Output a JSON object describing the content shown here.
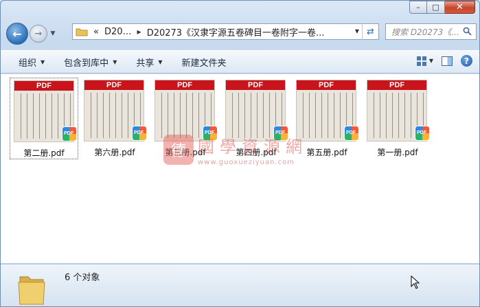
{
  "window": {
    "caption_buttons": {
      "minimize": "–",
      "maximize": "□",
      "close": "✕"
    }
  },
  "nav": {
    "back_icon": "arrow-left-icon",
    "forward_icon": "arrow-right-icon",
    "address": {
      "overflow": "«",
      "segment1": "D20…",
      "segment2": "D20273《汉隶字源五卷碑目一卷附字一卷..."
    },
    "search_placeholder": "搜索 D20273《..."
  },
  "toolbar": {
    "items": [
      {
        "label": "组织",
        "has_dropdown": true
      },
      {
        "label": "包含到库中",
        "has_dropdown": true
      },
      {
        "label": "共享",
        "has_dropdown": true
      },
      {
        "label": "新建文件夹",
        "has_dropdown": false
      }
    ]
  },
  "files": [
    {
      "name": "第二册.pdf",
      "badge": "PDF",
      "selected": true
    },
    {
      "name": "第六册.pdf",
      "badge": "PDF",
      "selected": false
    },
    {
      "name": "第三册.pdf",
      "badge": "PDF",
      "selected": false
    },
    {
      "name": "第四册.pdf",
      "badge": "PDF",
      "selected": false
    },
    {
      "name": "第五册.pdf",
      "badge": "PDF",
      "selected": false
    },
    {
      "name": "第一册.pdf",
      "badge": "PDF",
      "selected": false
    }
  ],
  "watermark": {
    "seal": "德",
    "text": "國學資源網",
    "url": "www.guoxueziyuan.com"
  },
  "status": {
    "count_text": "6 个对象"
  },
  "colors": {
    "pdf_banner": "#c8141a",
    "window_frame": "#c7daee",
    "close_button": "#c7442b"
  }
}
